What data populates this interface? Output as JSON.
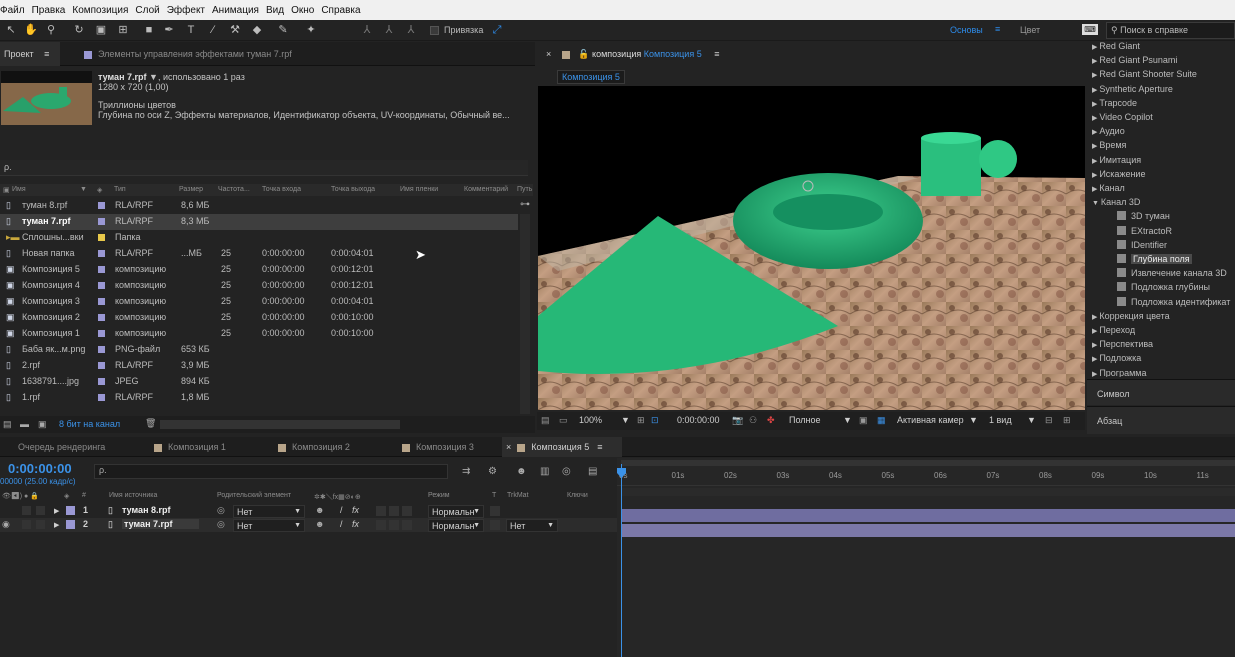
{
  "menu": [
    "Файл",
    "Правка",
    "Композиция",
    "Слой",
    "Эффект",
    "Анимация",
    "Вид",
    "Окно",
    "Справка"
  ],
  "toolbar": {
    "snap_label": "Привязка",
    "workspace_basic": "Основы",
    "workspace_menu": "≡",
    "workspace_color": "Цвет",
    "help_search_placeholder": "Поиск в справке"
  },
  "project_panel": {
    "tab_project": "Проект",
    "tab_menu": "≡",
    "tab_effects": "Элементы управления эффектами туман 7.rpf",
    "selected_name": "туман 7.rpf",
    "selected_used": ", использовано 1 раз",
    "selected_dims": "1280 x 720 (1,00)",
    "selected_info1": "Триллионы цветов",
    "selected_info2": "Глубина по оси Z, Эффекты материалов, Идентификатор объекта, UV-координаты, Обычный ве...",
    "search_placeholder": "ρ.",
    "columns": [
      "Имя",
      "Тип",
      "Размер",
      "Частота...",
      "Точка входа",
      "Точка выхода",
      "Имя пленки",
      "Комментарий",
      "Путь"
    ],
    "rows": [
      {
        "name": "туман 8.rpf",
        "color": "#9a98d4",
        "type": "RLA/RPF",
        "size": "8,6 МБ",
        "fps": "",
        "in": "",
        "out": ""
      },
      {
        "name": "туман 7.rpf",
        "color": "#9a98d4",
        "type": "RLA/RPF",
        "size": "8,3 МБ",
        "fps": "",
        "in": "",
        "out": ""
      },
      {
        "name": "Сплошны...вки",
        "color": "#e8c84a",
        "type": "Папка",
        "size": "",
        "fps": "",
        "in": "",
        "out": ""
      },
      {
        "name": "Новая папка",
        "color": "#9a98d4",
        "type": "RLA/RPF",
        "size": "...МБ",
        "fps": "25",
        "in": "0:00:00:00",
        "out": "0:00:04:01"
      },
      {
        "name": "Композиция 5",
        "color": "#9a98d4",
        "type": "композицию",
        "size": "",
        "fps": "25",
        "in": "0:00:00:00",
        "out": "0:00:12:01"
      },
      {
        "name": "Композиция 4",
        "color": "#9a98d4",
        "type": "композицию",
        "size": "",
        "fps": "25",
        "in": "0:00:00:00",
        "out": "0:00:12:01"
      },
      {
        "name": "Композиция 3",
        "color": "#9a98d4",
        "type": "композицию",
        "size": "",
        "fps": "25",
        "in": "0:00:00:00",
        "out": "0:00:04:01"
      },
      {
        "name": "Композиция 2",
        "color": "#9a98d4",
        "type": "композицию",
        "size": "",
        "fps": "25",
        "in": "0:00:00:00",
        "out": "0:00:10:00"
      },
      {
        "name": "Композиция 1",
        "color": "#9a98d4",
        "type": "композицию",
        "size": "",
        "fps": "25",
        "in": "0:00:00:00",
        "out": "0:00:10:00"
      },
      {
        "name": "Баба як...м.png",
        "color": "#9a98d4",
        "type": "PNG-файл",
        "size": "653 КБ",
        "fps": "",
        "in": "",
        "out": ""
      },
      {
        "name": "2.rpf",
        "color": "#9a98d4",
        "type": "RLA/RPF",
        "size": "3,9 МБ",
        "fps": "",
        "in": "",
        "out": ""
      },
      {
        "name": "1638791....jpg",
        "color": "#9a98d4",
        "type": "JPEG",
        "size": "894 КБ",
        "fps": "",
        "in": "",
        "out": ""
      },
      {
        "name": "1.rpf",
        "color": "#9a98d4",
        "type": "RLA/RPF",
        "size": "1,8 МБ",
        "fps": "",
        "in": "",
        "out": ""
      }
    ],
    "footer_bits": "8 бит на канал"
  },
  "viewer": {
    "tab_label": "композиция",
    "tab_comp": "Композиция 5",
    "tab_menu": "≡",
    "breadcrumb": "Композиция 5",
    "zoom": "100%",
    "timecode": "0:00:00:00",
    "resolution": "Полное",
    "camera": "Активная камер",
    "views": "1 вид"
  },
  "effects_panel": {
    "items": [
      {
        "label": "Red Giant",
        "arrow": "▶",
        "indent": 0,
        "icon": false
      },
      {
        "label": "Red Giant Psunami",
        "arrow": "▶",
        "indent": 0,
        "icon": false
      },
      {
        "label": "Red Giant Shooter Suite",
        "arrow": "▶",
        "indent": 0,
        "icon": false
      },
      {
        "label": "Synthetic Aperture",
        "arrow": "▶",
        "indent": 0,
        "icon": false
      },
      {
        "label": "Trapcode",
        "arrow": "▶",
        "indent": 0,
        "icon": false
      },
      {
        "label": "Video Copilot",
        "arrow": "▶",
        "indent": 0,
        "icon": false
      },
      {
        "label": "Аудио",
        "arrow": "▶",
        "indent": 0,
        "icon": false
      },
      {
        "label": "Время",
        "arrow": "▶",
        "indent": 0,
        "icon": false
      },
      {
        "label": "Имитация",
        "arrow": "▶",
        "indent": 0,
        "icon": false
      },
      {
        "label": "Искажение",
        "arrow": "▶",
        "indent": 0,
        "icon": false
      },
      {
        "label": "Канал",
        "arrow": "▶",
        "indent": 0,
        "icon": false
      },
      {
        "label": "Канал 3D",
        "arrow": "▼",
        "indent": 0,
        "icon": false
      },
      {
        "label": "3D туман",
        "arrow": "",
        "indent": 1,
        "icon": true
      },
      {
        "label": "EXtractoR",
        "arrow": "",
        "indent": 1,
        "icon": true
      },
      {
        "label": "IDentifier",
        "arrow": "",
        "indent": 1,
        "icon": true
      },
      {
        "label": "Глубина поля",
        "arrow": "",
        "indent": 1,
        "icon": true
      },
      {
        "label": "Извлечение канала 3D",
        "arrow": "",
        "indent": 1,
        "icon": true
      },
      {
        "label": "Подложка глубины",
        "arrow": "",
        "indent": 1,
        "icon": true
      },
      {
        "label": "Подложка идентификат",
        "arrow": "",
        "indent": 1,
        "icon": true
      },
      {
        "label": "Коррекция цвета",
        "arrow": "▶",
        "indent": 0,
        "icon": false
      },
      {
        "label": "Переход",
        "arrow": "▶",
        "indent": 0,
        "icon": false
      },
      {
        "label": "Перспектива",
        "arrow": "▶",
        "indent": 0,
        "icon": false
      },
      {
        "label": "Подложка",
        "arrow": "▶",
        "indent": 0,
        "icon": false
      },
      {
        "label": "Программа",
        "arrow": "▶",
        "indent": 0,
        "icon": false
      }
    ],
    "selected_index": 15,
    "symbol_panel": "Символ",
    "paragraph_panel": "Абзац"
  },
  "timeline": {
    "tabs": [
      {
        "label": "Очередь рендеринга",
        "color": ""
      },
      {
        "label": "Композиция 1",
        "color": "#b8a58a"
      },
      {
        "label": "Композиция 2",
        "color": "#b8a58a"
      },
      {
        "label": "Композиция 3",
        "color": "#b8a58a"
      },
      {
        "label": "Композиция 5",
        "color": "#b8a58a"
      }
    ],
    "close_x": "×",
    "tab_menu": "≡",
    "timecode": "0:00:00:00",
    "fps_label": "00000 (25.00 кадр/с)",
    "search_placeholder": "ρ.",
    "columns": [
      "#",
      "Имя источника",
      "Родительский элемент",
      "Режим",
      "T",
      "TrkMat",
      "Ключи"
    ],
    "layers": [
      {
        "num": "1",
        "name": "туман 8.rpf",
        "parent": "Нет",
        "mode": "Нормальн",
        "trkmat": ""
      },
      {
        "num": "2",
        "name": "туман 7.rpf",
        "parent": "Нет",
        "mode": "Нормальн",
        "trkmat": "Нет"
      }
    ],
    "ruler": [
      "0s",
      "01s",
      "02s",
      "03s",
      "04s",
      "05s",
      "06s",
      "07s",
      "08s",
      "09s",
      "10s",
      "11s"
    ]
  }
}
